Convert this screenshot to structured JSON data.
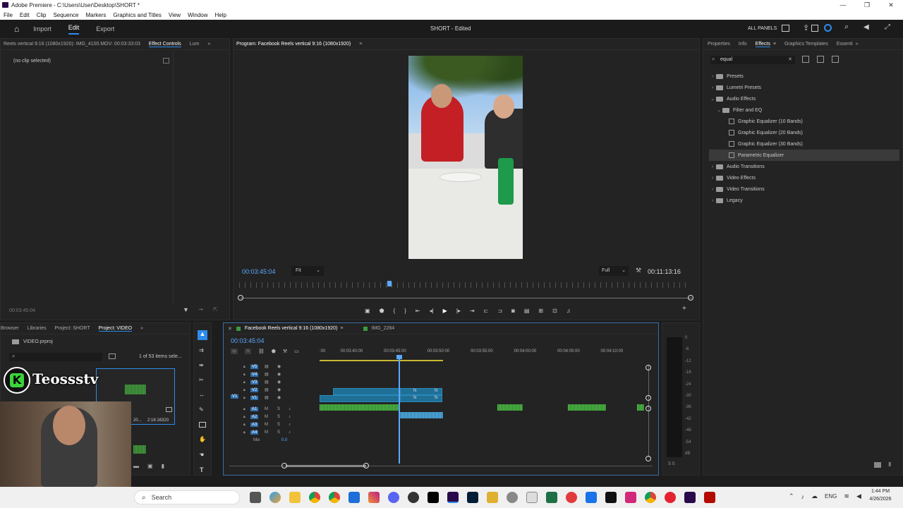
{
  "window": {
    "title": "Adobe Premiere - C:\\Users\\User\\Desktop\\SHORT *"
  },
  "menu": [
    "File",
    "Edit",
    "Clip",
    "Sequence",
    "Markers",
    "Graphics and Titles",
    "View",
    "Window",
    "Help"
  ],
  "appbar": {
    "import": "Import",
    "edit": "Edit",
    "export": "Export",
    "project_title": "SHORT - Edited",
    "all_panels": "ALL PANELS"
  },
  "effect_controls": {
    "tab_source": "Reels vertical 9:16 (1080x1920): IMG_4100.MOV: 00:03:33:03",
    "tab_effect_controls": "Effect Controls",
    "tab_lumetri": "Lum",
    "no_clip": "(no clip selected)",
    "timecode": "00:03:45:04"
  },
  "program": {
    "title": "Program: Facebook Reels vertical 9:16 (1080x1920)",
    "timecode": "00:03:45:04",
    "fit": "Fit",
    "quality": "Full",
    "duration": "00:11:13:16"
  },
  "effects": {
    "tabs": [
      "Properties",
      "Info",
      "Effects",
      "Graphics Templates",
      "Essenti"
    ],
    "search_value": "equal",
    "tree": [
      {
        "label": "Presets",
        "level": 0,
        "type": "folder",
        "open": false
      },
      {
        "label": "Lumetri Presets",
        "level": 0,
        "type": "folder",
        "open": false
      },
      {
        "label": "Audio Effects",
        "level": 0,
        "type": "folder",
        "open": true
      },
      {
        "label": "Filter and EQ",
        "level": 1,
        "type": "folder",
        "open": true
      },
      {
        "label": "Graphic Equalizer (10 Bands)",
        "level": 2,
        "type": "fx"
      },
      {
        "label": "Graphic Equalizer (20 Bands)",
        "level": 2,
        "type": "fx"
      },
      {
        "label": "Graphic Equalizer (30 Bands)",
        "level": 2,
        "type": "fx"
      },
      {
        "label": "Parametric Equalizer",
        "level": 2,
        "type": "fx",
        "selected": true
      },
      {
        "label": "Audio Transitions",
        "level": 0,
        "type": "folder",
        "open": false
      },
      {
        "label": "Video Effects",
        "level": 0,
        "type": "folder",
        "open": false
      },
      {
        "label": "Video Transitions",
        "level": 0,
        "type": "folder",
        "open": false
      },
      {
        "label": "Legacy",
        "level": 0,
        "type": "folder",
        "open": false
      }
    ]
  },
  "project": {
    "tabs": [
      "Browser",
      "Libraries",
      "Project: SHORT",
      "Project: VIDEO"
    ],
    "file": "VIDEO.prproj",
    "count": "1 of 53 items sele...",
    "clip_duration": "2:16:16320",
    "clip_prefix": "20..."
  },
  "webcam": {
    "brand": "Teossstv"
  },
  "timeline": {
    "tabs": [
      "Facebook Reels vertical 9:16 (1080x1920)",
      "IMG_2284"
    ],
    "timecode": "00:03:45:04",
    "ruler": [
      ":00",
      "00:03:40:00",
      "00:03:45:00",
      "00:03:50:00",
      "00:03:55:00",
      "00:04:00:00",
      "00:04:05:00",
      "00:04:10:00"
    ],
    "video_tracks": [
      "V5",
      "V4",
      "V3",
      "V2",
      "V1"
    ],
    "audio_tracks": [
      "A1",
      "A2",
      "A3",
      "A4"
    ],
    "mix_label": "Mix",
    "mix_value": "0.0",
    "v1_source": "V1"
  },
  "meter": {
    "scale": [
      "0",
      "-6",
      "-12",
      "-18",
      "-24",
      "-30",
      "-36",
      "-42",
      "-48",
      "-54",
      "dB"
    ],
    "footer": "S S"
  },
  "taskbar": {
    "search": "Search",
    "lang": "ENG",
    "time": "1:44 PM",
    "date": "4/26/2026"
  },
  "colors": {
    "accent": "#2d8ceb",
    "timecode": "#5aa9ff",
    "video_clip": "#1f6f97",
    "audio_wave": "#58c04a"
  }
}
